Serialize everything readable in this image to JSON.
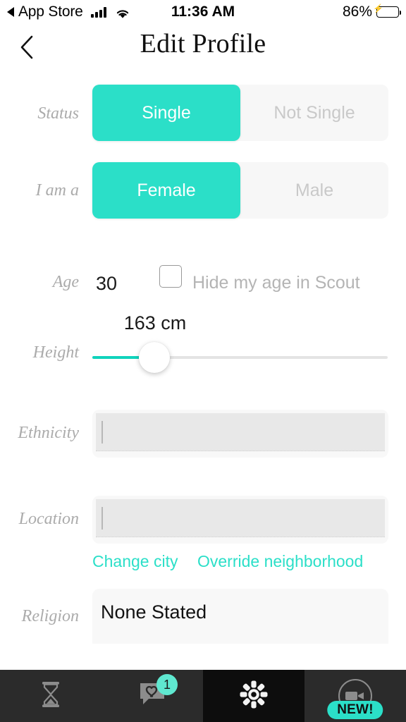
{
  "status_bar": {
    "carrier_back": "App Store",
    "back_arrow_icon": "triangle-left-icon",
    "signal_icon": "cellular-signal-icon",
    "wifi_icon": "wifi-icon",
    "time": "11:36 AM",
    "battery_percent": "86%",
    "battery_icon": "battery-charging-icon",
    "battery_color": "#44D865"
  },
  "navbar": {
    "back_icon": "chevron-left-icon",
    "title": "Edit Profile"
  },
  "theme": {
    "accent": "#2BDFC8",
    "accent_track": "#0FD3BC",
    "inactive_text": "#C9C9C9",
    "label_color": "#ABABAB",
    "field_bg": "#F8F8F8",
    "input_bg": "#E8E8E8",
    "tabbar_bg": "#2B2B2B",
    "tab_active_bg": "#0D0D0D"
  },
  "form": {
    "status": {
      "label": "Status",
      "options": [
        "Single",
        "Not Single"
      ],
      "selected": "Single"
    },
    "gender": {
      "label": "I am a",
      "options": [
        "Female",
        "Male"
      ],
      "selected": "Female"
    },
    "age": {
      "label": "Age",
      "value": "30",
      "hide_age_label": "Hide my age in Scout",
      "hide_age_checked": false,
      "checkbox_icon": "checkbox-unchecked-icon"
    },
    "height": {
      "label": "Height",
      "value": "163 cm",
      "percent": 21
    },
    "ethnicity": {
      "label": "Ethnicity",
      "value": "",
      "placeholder": ""
    },
    "location": {
      "label": "Location",
      "value": "",
      "placeholder": "",
      "link_change_city": "Change city",
      "link_override_neighborhood": "Override neighborhood"
    },
    "religion": {
      "label": "Religion",
      "value": "None Stated"
    }
  },
  "tabbar": {
    "items": [
      {
        "name": "hourglass",
        "icon": "hourglass-icon",
        "active": false,
        "badge": ""
      },
      {
        "name": "messages",
        "icon": "chat-heart-icon",
        "active": false,
        "badge": "1"
      },
      {
        "name": "settings",
        "icon": "gear-icon",
        "active": true,
        "badge": ""
      },
      {
        "name": "video",
        "icon": "video-camera-icon",
        "active": false,
        "badge": "NEW!"
      }
    ]
  }
}
